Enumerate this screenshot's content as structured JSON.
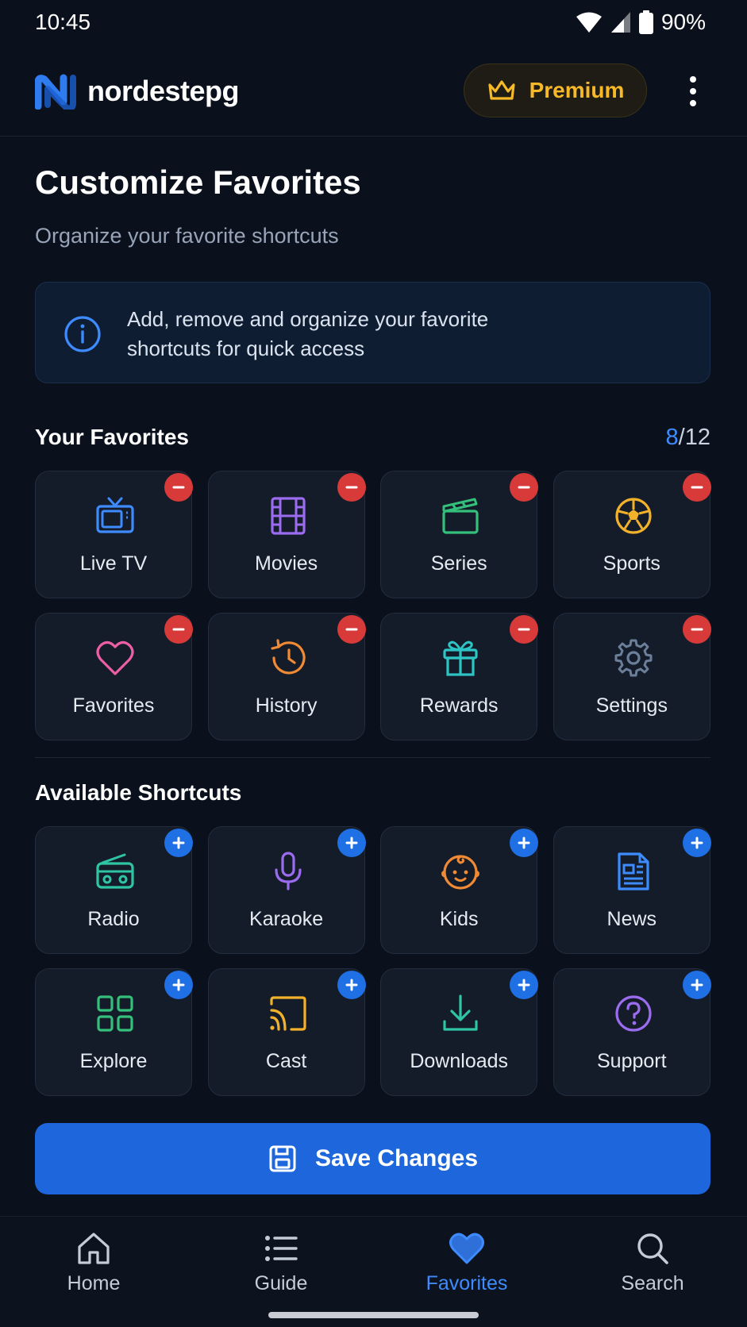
{
  "status": {
    "time": "10:45",
    "battery": "90%"
  },
  "app": {
    "name": "nordestepg",
    "premium_label": "Premium"
  },
  "page": {
    "title": "Customize Favorites",
    "subtitle": "Organize your favorite shortcuts",
    "info_text": "Add, remove and organize your favorite shortcuts for quick access"
  },
  "favorites": {
    "heading": "Your Favorites",
    "count_current": "8",
    "count_total": "/12",
    "items": [
      {
        "label": "Live TV",
        "icon": "tv-icon",
        "color": "#3d8bfd"
      },
      {
        "label": "Movies",
        "icon": "film-icon",
        "color": "#9b6cf0"
      },
      {
        "label": "Series",
        "icon": "clapperboard-icon",
        "color": "#34c07a"
      },
      {
        "label": "Sports",
        "icon": "soccer-ball-icon",
        "color": "#f2b12a"
      },
      {
        "label": "Favorites",
        "icon": "heart-icon",
        "color": "#ec5fa4"
      },
      {
        "label": "History",
        "icon": "history-icon",
        "color": "#f08a34"
      },
      {
        "label": "Rewards",
        "icon": "gift-icon",
        "color": "#2ec4c4"
      },
      {
        "label": "Settings",
        "icon": "gear-icon",
        "color": "#6c7f9a"
      }
    ]
  },
  "available": {
    "heading": "Available Shortcuts",
    "items": [
      {
        "label": "Radio",
        "icon": "radio-icon",
        "color": "#2ec4a4"
      },
      {
        "label": "Karaoke",
        "icon": "microphone-icon",
        "color": "#9b6cf0"
      },
      {
        "label": "Kids",
        "icon": "baby-face-icon",
        "color": "#f08a34"
      },
      {
        "label": "News",
        "icon": "newspaper-icon",
        "color": "#3d8bfd"
      },
      {
        "label": "Explore",
        "icon": "grid-icon",
        "color": "#34c07a"
      },
      {
        "label": "Cast",
        "icon": "cast-icon",
        "color": "#f2b12a"
      },
      {
        "label": "Downloads",
        "icon": "download-icon",
        "color": "#2ec4a4"
      },
      {
        "label": "Support",
        "icon": "help-circle-icon",
        "color": "#9b6cf0"
      }
    ]
  },
  "save_label": "Save Changes",
  "nav": [
    {
      "label": "Home",
      "icon": "home-icon"
    },
    {
      "label": "Guide",
      "icon": "list-icon"
    },
    {
      "label": "Favorites",
      "icon": "heart-icon",
      "active": true
    },
    {
      "label": "Search",
      "icon": "search-icon"
    }
  ],
  "colors": {
    "accent": "#1d66dc",
    "premium": "#f7b928",
    "remove": "#d83a3a",
    "add": "#1f6fe5",
    "background": "#0b111c"
  }
}
